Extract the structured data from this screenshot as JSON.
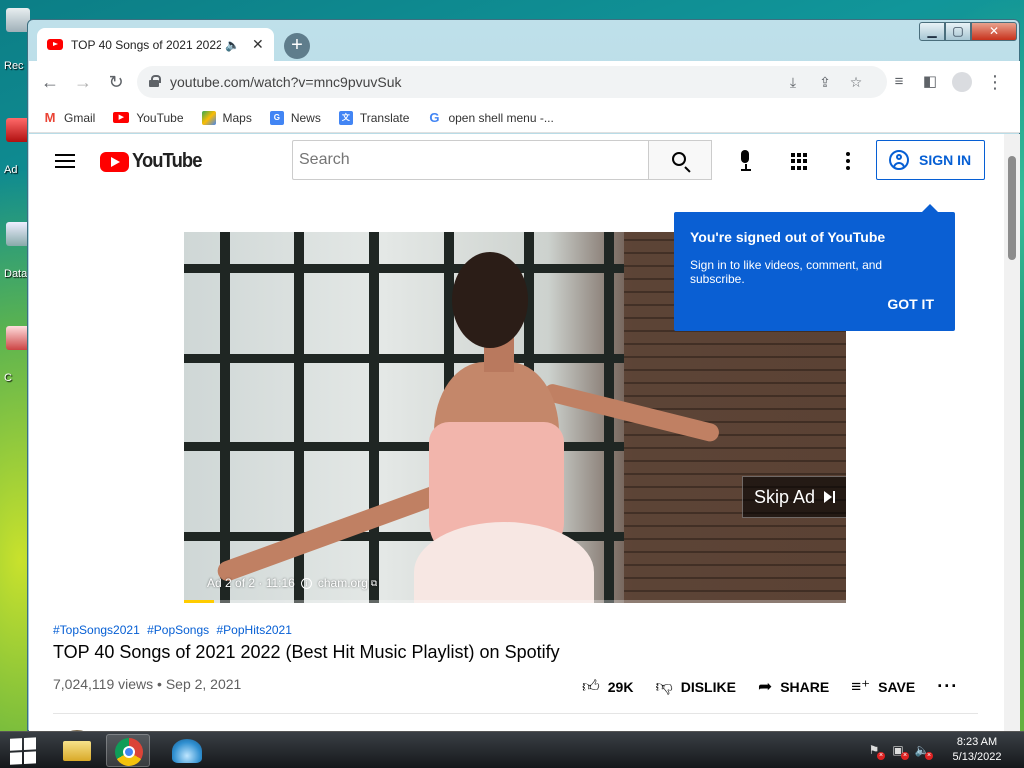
{
  "desktop": {
    "icons": [
      {
        "label": "Rec"
      },
      {
        "label": "Ad"
      },
      {
        "label": "Data"
      },
      {
        "label": "C"
      }
    ]
  },
  "browser": {
    "tab": {
      "title": "TOP 40 Songs of 2021 2022 (Best Hit Music Playlist) on Spotify",
      "close": "✕"
    },
    "new_tab": "+",
    "url": "youtube.com/watch?v=mnc9pvuvSuk",
    "bookmarks": [
      {
        "label": "Gmail"
      },
      {
        "label": "YouTube"
      },
      {
        "label": "Maps"
      },
      {
        "label": "News"
      },
      {
        "label": "Translate"
      },
      {
        "label": "open shell menu -..."
      }
    ]
  },
  "youtube": {
    "logo_text": "YouTube",
    "search_placeholder": "Search",
    "sign_in": "SIGN IN",
    "popup": {
      "title": "You're signed out of YouTube",
      "text": "Sign in to like videos, comment, and subscribe.",
      "button": "GOT IT"
    },
    "ad": {
      "counter": "Ad 2 of 2 · 11:16",
      "domain": "cham.org",
      "skip": "Skip Ad",
      "progress": 0.045
    },
    "video": {
      "tags": [
        "#TopSongs2021",
        "#PopSongs",
        "#PopHits2021"
      ],
      "title": "TOP 40 Songs of 2021 2022 (Best Hit Music Playlist) on Spotify",
      "meta": "7,024,119 views • Sep 2, 2021",
      "likes": "29K",
      "dislike": "DISLIKE",
      "share": "SHARE",
      "save": "SAVE"
    }
  },
  "taskbar": {
    "time": "8:23 AM",
    "date": "5/13/2022"
  },
  "colors": {
    "yt_red": "#ff0000",
    "yt_blue": "#065fd4",
    "popup_blue": "#0a5fd3"
  }
}
